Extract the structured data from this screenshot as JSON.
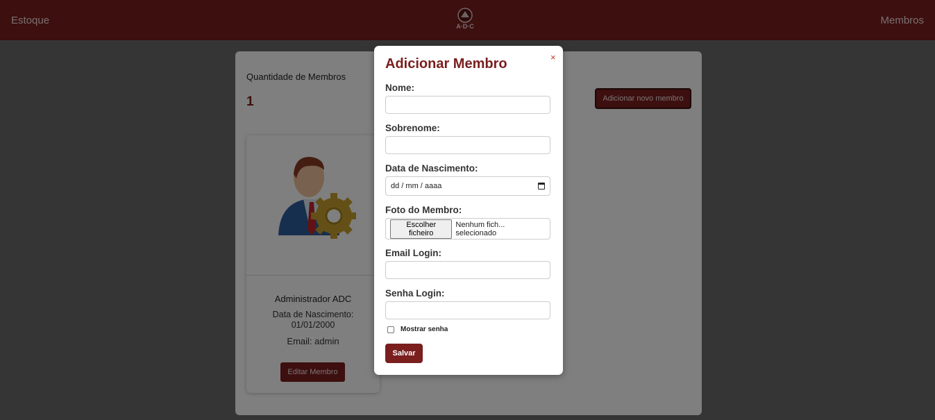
{
  "nav": {
    "left_link": "Estoque",
    "logo_text": "A·D·C",
    "right_link": "Membros"
  },
  "panel": {
    "count_label": "Quantidade de Membros",
    "count_value": "1",
    "add_button": "Adicionar novo membro"
  },
  "member": {
    "name": "Administrador ADC",
    "birth_label": "Data de Nascimento:",
    "birth_date": "01/01/2000",
    "email": "Email: admin",
    "edit_button": "Editar Membro"
  },
  "modal": {
    "title": "Adicionar Membro",
    "close": "×",
    "fields": {
      "nome_label": "Nome:",
      "sobrenome_label": "Sobrenome:",
      "nascimento_label": "Data de Nascimento:",
      "nascimento_placeholder": "dd / mm / aaaa",
      "foto_label": "Foto do Membro:",
      "file_button": "Escolher ficheiro",
      "file_status": "Nenhum fich... selecionado",
      "email_label": "Email Login:",
      "senha_label": "Senha Login:"
    },
    "show_password": "Mostrar senha",
    "save_button": "Salvar"
  },
  "colors": {
    "brand": "#7a1e1e",
    "overlay": "rgba(0,0,0,0.5)"
  }
}
